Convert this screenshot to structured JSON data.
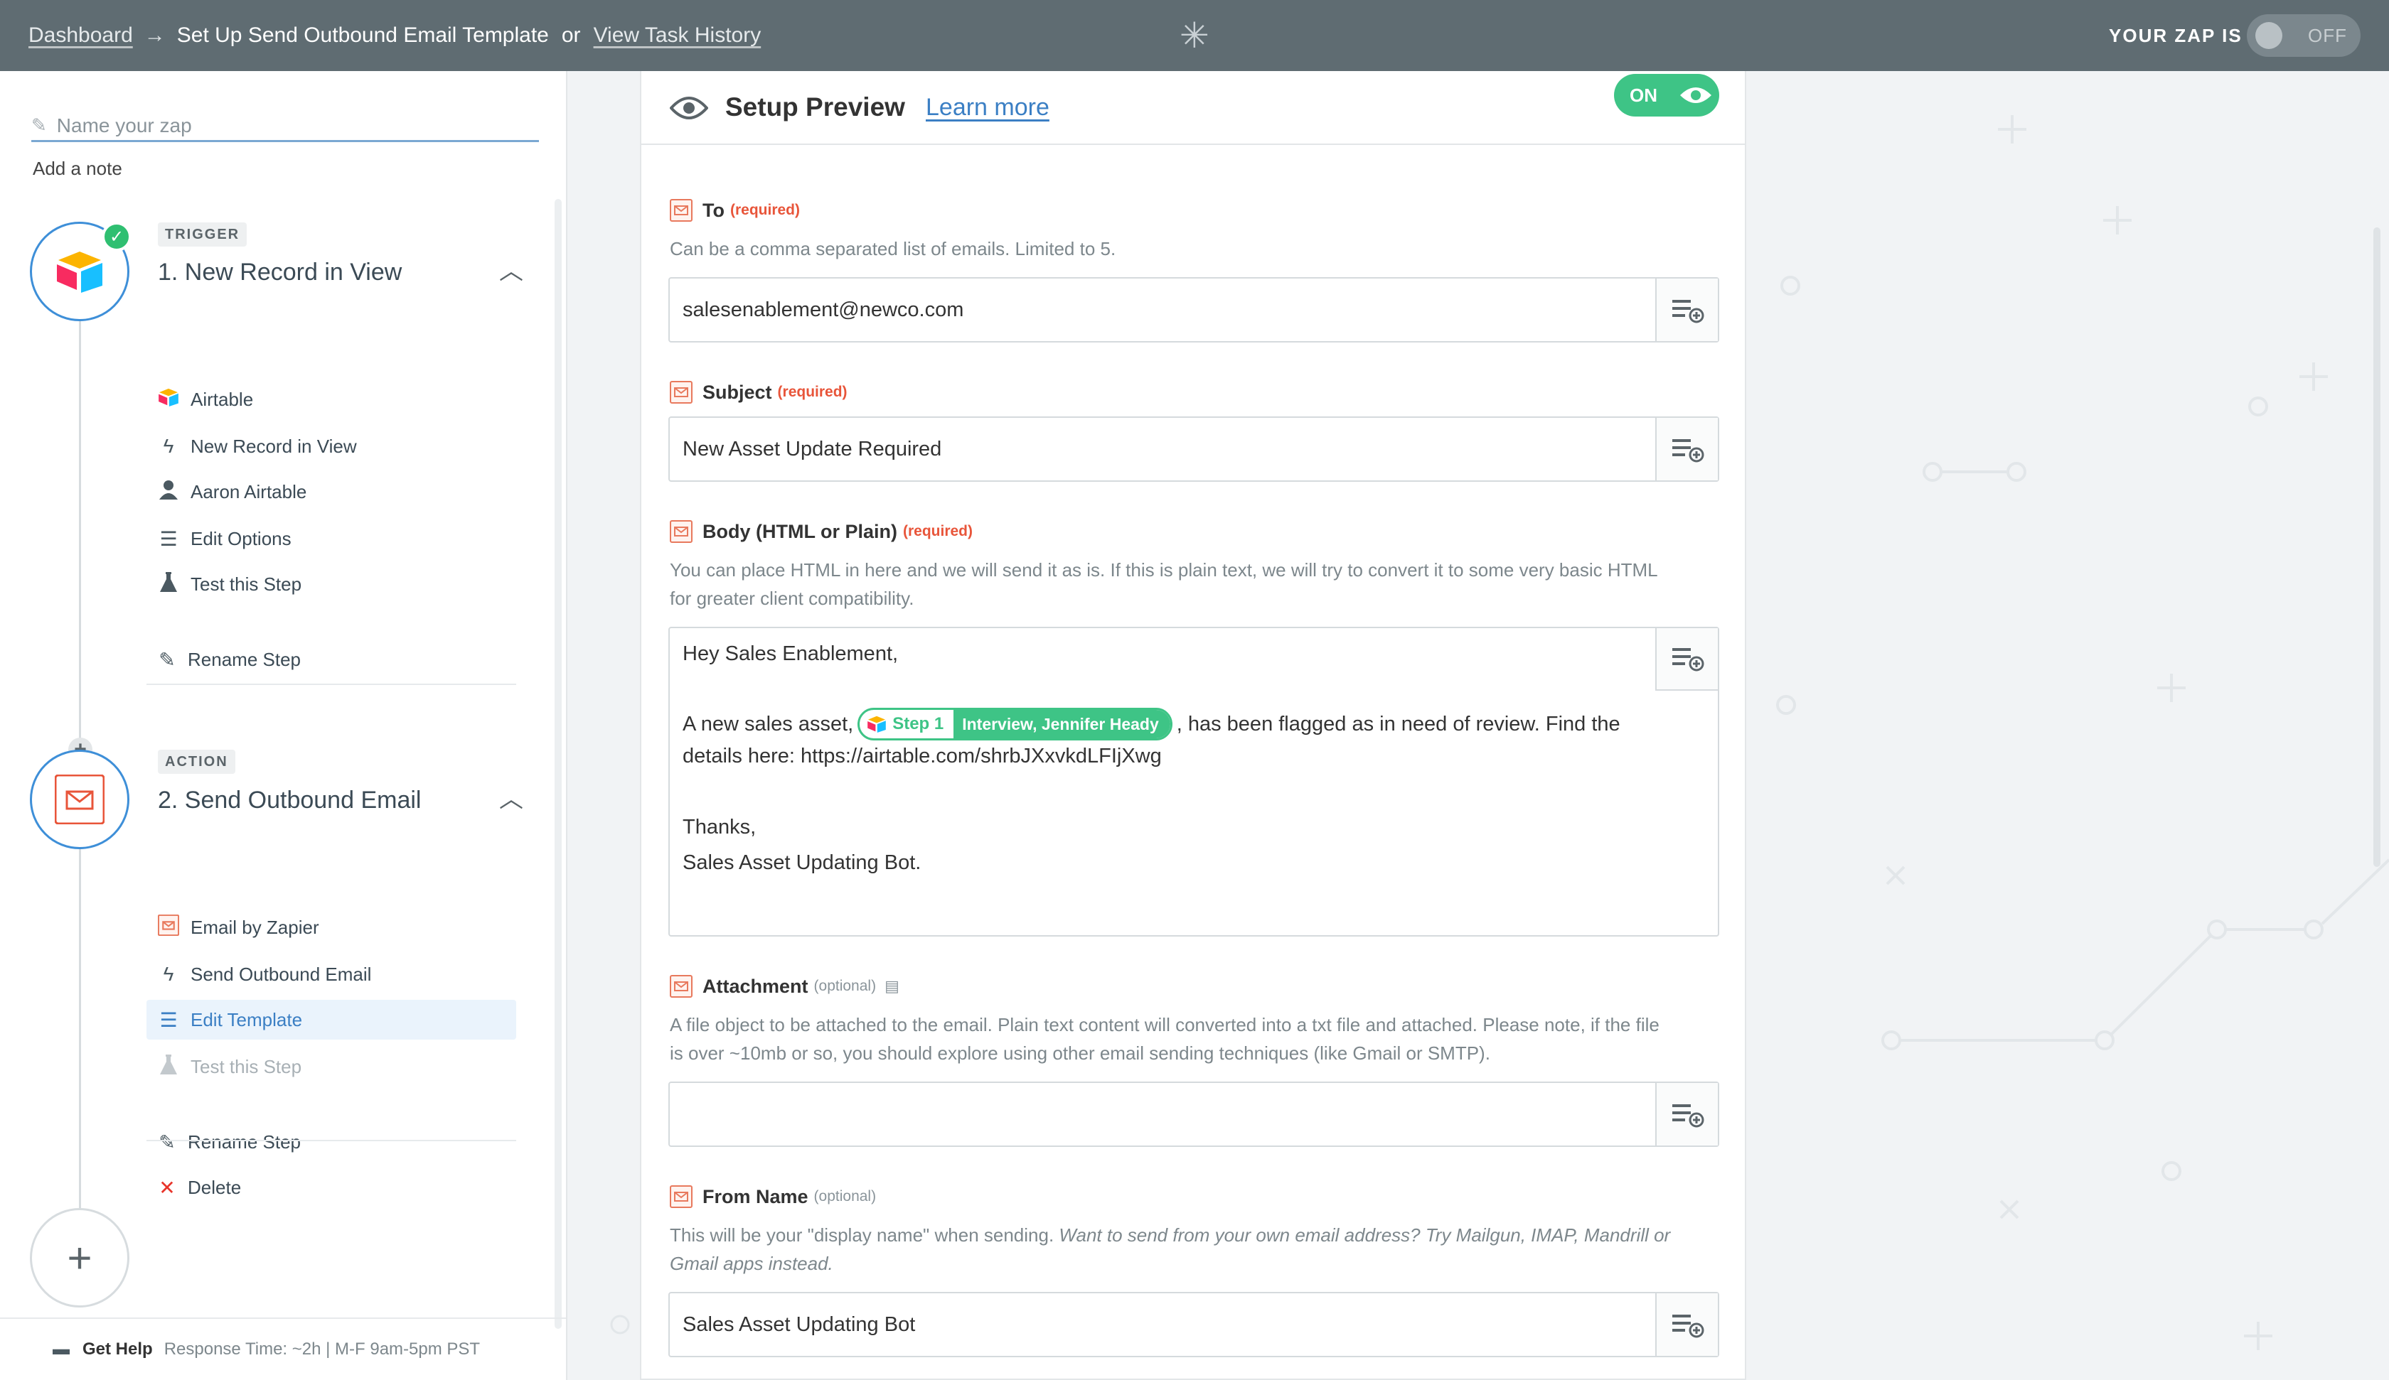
{
  "topbar": {
    "dashboard": "Dashboard",
    "arrow": "→",
    "current": "Set Up Send Outbound Email Template",
    "or": "or",
    "history": "View Task History",
    "zap_is": "YOUR ZAP IS",
    "toggle": "OFF"
  },
  "sidebar": {
    "name_placeholder": "Name your zap",
    "add_note": "Add a note",
    "trigger": {
      "tag": "TRIGGER",
      "title": "1. New Record in View",
      "items": [
        "Airtable",
        "New Record in View",
        "Aaron Airtable",
        "Edit Options",
        "Test this Step"
      ],
      "rename": "Rename Step"
    },
    "action": {
      "tag": "ACTION",
      "title": "2. Send Outbound Email",
      "items": [
        "Email by Zapier",
        "Send Outbound Email",
        "Edit Template",
        "Test this Step"
      ],
      "rename": "Rename Step",
      "delete": "Delete"
    },
    "help": {
      "label": "Get Help",
      "response": "Response Time: ~2h | M-F 9am-5pm PST"
    }
  },
  "panel": {
    "title": "Setup Preview",
    "learn_more": "Learn more",
    "toggle": "ON",
    "fields": {
      "to": {
        "label": "To",
        "badge": "(required)",
        "help": "Can be a comma separated list of emails. Limited to 5.",
        "value": "salesenablement@newco.com"
      },
      "subject": {
        "label": "Subject",
        "badge": "(required)",
        "value": "New Asset Update Required"
      },
      "body": {
        "label": "Body (HTML or Plain)",
        "badge": "(required)",
        "help1": "You can place HTML in here and we will send it as is. If this is plain text, we will try to convert it to some very basic HTML",
        "help2": "for greater client compatibility.",
        "line1": "Hey Sales Enablement,",
        "line2_pre": "A new sales asset,",
        "pill_step": "Step 1",
        "pill_value": "Interview, Jennifer Heady",
        "line2_post": ", has been flagged as in need of review. Find the",
        "line3": "details here: https://airtable.com/shrbJXxvkdLFIjXwg",
        "line4": "Thanks,",
        "line5": "Sales Asset Updating Bot."
      },
      "attachment": {
        "label": "Attachment",
        "badge": "(optional)",
        "help1": "A file object to be attached to the email. Plain text content will converted into a txt file and attached. Please note, if the file",
        "help2": "is over ~10mb or so, you should explore using other email sending techniques (like Gmail or SMTP).",
        "value": ""
      },
      "from_name": {
        "label": "From Name",
        "badge": "(optional)",
        "help_plain": "This will be your \"display name\" when sending.",
        "help_italic1": "Want to send from your own email address? Try Mailgun, IMAP, Mandrill or",
        "help_italic2": "Gmail apps instead.",
        "value": "Sales Asset Updating Bot"
      }
    }
  },
  "colors": {
    "topbar": "#5f6c72",
    "accent_blue": "#3b7fc4",
    "accent_green": "#3ec486",
    "required_red": "#e8553a"
  },
  "icons": [
    "zapier-logo-icon",
    "pencil-icon",
    "check-icon",
    "airtable-icon",
    "bolt-icon",
    "user-icon",
    "lines-icon",
    "flask-icon",
    "mail-icon",
    "x-icon",
    "plus-icon",
    "chat-icon",
    "eye-icon",
    "insert-field-icon",
    "doc-icon"
  ]
}
